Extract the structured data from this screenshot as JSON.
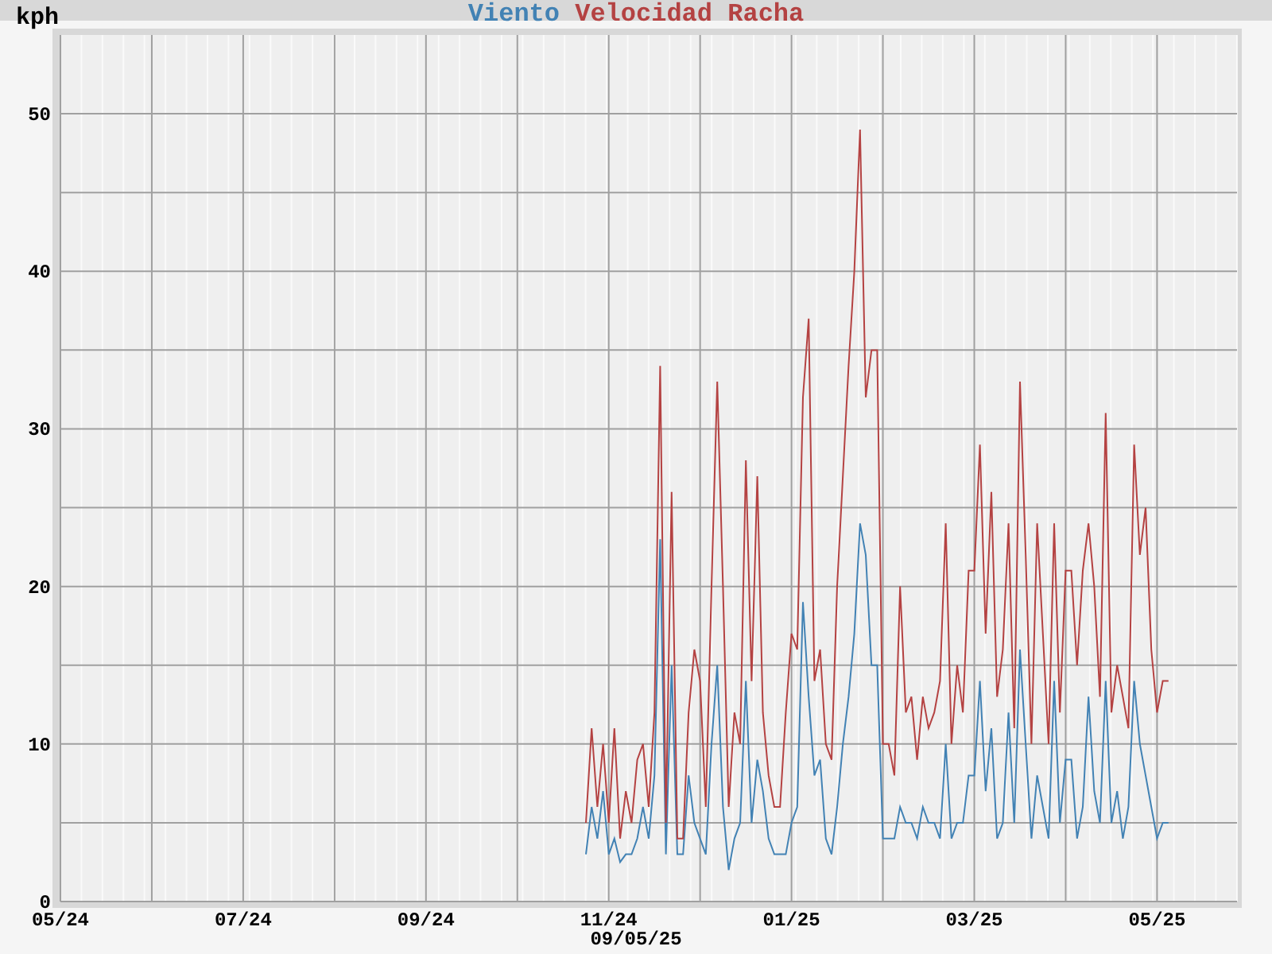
{
  "chart_data": {
    "type": "line",
    "ylabel": "kph",
    "categories": [
      "05/24",
      null,
      null,
      null,
      null,
      null,
      null,
      null,
      null,
      null,
      null,
      null,
      null,
      null,
      null,
      null,
      null,
      null,
      null,
      null,
      null,
      null,
      null,
      null,
      null,
      null,
      null,
      null,
      null,
      null,
      null,
      null,
      "07/24",
      null,
      null,
      null,
      null,
      null,
      null,
      null,
      null,
      null,
      null,
      null,
      null,
      null,
      null,
      null,
      null,
      null,
      null,
      null,
      null,
      null,
      null,
      null,
      null,
      null,
      null,
      null,
      null,
      null,
      null,
      null,
      "09/24",
      null,
      null,
      null,
      null,
      null,
      null,
      null,
      null,
      null,
      null,
      null,
      null,
      null,
      null,
      null,
      null,
      null,
      null,
      null,
      null,
      null,
      null,
      null,
      null,
      null,
      null,
      null,
      null,
      null,
      null,
      null,
      "11/24",
      null,
      null,
      null,
      null,
      null,
      null,
      null,
      null,
      null,
      null,
      null,
      null,
      null,
      null,
      null,
      null,
      null,
      null,
      null,
      null,
      null,
      null,
      null,
      null,
      null,
      null,
      null,
      null,
      null,
      null,
      null,
      "01/25",
      null,
      null,
      null,
      null,
      null,
      null,
      null,
      null,
      null,
      null,
      null,
      null,
      null,
      null,
      null,
      null,
      null,
      null,
      null,
      null,
      null,
      null,
      null,
      null,
      null,
      null,
      null,
      null,
      null,
      null,
      null,
      "03/25",
      null,
      null,
      null,
      null,
      null,
      null,
      null,
      null,
      null,
      null,
      null,
      null,
      null,
      null,
      null,
      null,
      null,
      null,
      null,
      null,
      null,
      null,
      null,
      null,
      null,
      null,
      null,
      null,
      null,
      null,
      null,
      "05/25",
      null,
      null,
      null,
      null,
      null,
      null,
      null,
      null,
      null,
      null,
      null,
      null,
      null
    ],
    "series": [
      {
        "name": "Viento",
        "color": "#4282b4",
        "values": [
          null,
          null,
          null,
          null,
          null,
          null,
          null,
          null,
          null,
          null,
          null,
          null,
          null,
          null,
          null,
          null,
          null,
          null,
          null,
          null,
          null,
          null,
          null,
          null,
          null,
          null,
          null,
          null,
          null,
          null,
          null,
          null,
          null,
          null,
          null,
          null,
          null,
          null,
          null,
          null,
          null,
          null,
          null,
          null,
          null,
          null,
          null,
          null,
          null,
          null,
          null,
          null,
          null,
          null,
          null,
          null,
          null,
          null,
          null,
          null,
          null,
          null,
          null,
          null,
          null,
          null,
          null,
          null,
          null,
          null,
          null,
          null,
          null,
          null,
          null,
          null,
          null,
          null,
          null,
          null,
          null,
          null,
          null,
          null,
          null,
          null,
          null,
          null,
          null,
          null,
          null,
          null,
          3,
          6,
          4,
          7,
          3,
          4,
          2.5,
          3,
          3,
          4,
          6,
          4,
          8,
          23,
          3,
          15,
          3,
          3,
          8,
          5,
          4,
          3,
          10,
          15,
          6,
          2,
          4,
          5,
          14,
          5,
          9,
          7,
          4,
          3,
          3,
          3,
          5,
          6,
          19,
          13,
          8,
          9,
          4,
          3,
          6,
          10,
          13,
          17,
          24,
          22,
          15,
          15,
          4,
          4,
          4,
          6,
          5,
          5,
          4,
          6,
          5,
          5,
          4,
          10,
          4,
          5,
          5,
          8,
          8,
          14,
          7,
          11,
          4,
          5,
          12,
          5,
          16,
          10,
          4,
          8,
          6,
          4,
          14,
          5,
          9,
          9,
          4,
          6,
          13,
          7,
          5,
          14,
          5,
          7,
          4,
          6,
          14,
          10,
          8,
          6,
          4,
          5,
          5,
          null,
          null,
          null,
          null,
          null,
          null,
          null,
          null,
          null,
          null,
          null
        ]
      },
      {
        "name": "Velocidad Racha",
        "color": "#b44242",
        "values": [
          null,
          null,
          null,
          null,
          null,
          null,
          null,
          null,
          null,
          null,
          null,
          null,
          null,
          null,
          null,
          null,
          null,
          null,
          null,
          null,
          null,
          null,
          null,
          null,
          null,
          null,
          null,
          null,
          null,
          null,
          null,
          null,
          null,
          null,
          null,
          null,
          null,
          null,
          null,
          null,
          null,
          null,
          null,
          null,
          null,
          null,
          null,
          null,
          null,
          null,
          null,
          null,
          null,
          null,
          null,
          null,
          null,
          null,
          null,
          null,
          null,
          null,
          null,
          null,
          null,
          null,
          null,
          null,
          null,
          null,
          null,
          null,
          null,
          null,
          null,
          null,
          null,
          null,
          null,
          null,
          null,
          null,
          null,
          null,
          null,
          null,
          null,
          null,
          null,
          null,
          null,
          null,
          5,
          11,
          6,
          10,
          5,
          11,
          4,
          7,
          5,
          9,
          10,
          6,
          12,
          34,
          5,
          26,
          4,
          4,
          12,
          16,
          14,
          6,
          20,
          33,
          20,
          6,
          12,
          10,
          28,
          14,
          27,
          12,
          8,
          6,
          6,
          12,
          17,
          16,
          32,
          37,
          14,
          16,
          10,
          9,
          20,
          27,
          34,
          40,
          49,
          32,
          35,
          35,
          10,
          10,
          8,
          20,
          12,
          13,
          9,
          13,
          11,
          12,
          14,
          24,
          10,
          15,
          12,
          21,
          21,
          29,
          17,
          26,
          13,
          16,
          24,
          11,
          33,
          22,
          10,
          24,
          17,
          10,
          24,
          12,
          21,
          21,
          15,
          21,
          24,
          20,
          13,
          31,
          12,
          15,
          13,
          11,
          29,
          22,
          25,
          16,
          12,
          14,
          14,
          null,
          null,
          null,
          null,
          null,
          null,
          null,
          null,
          null,
          null,
          null
        ]
      }
    ],
    "grid": true,
    "ylim": [
      0,
      55
    ],
    "yticks": [
      0,
      10,
      20,
      30,
      40,
      50
    ]
  },
  "timestamp": "09/05/25"
}
